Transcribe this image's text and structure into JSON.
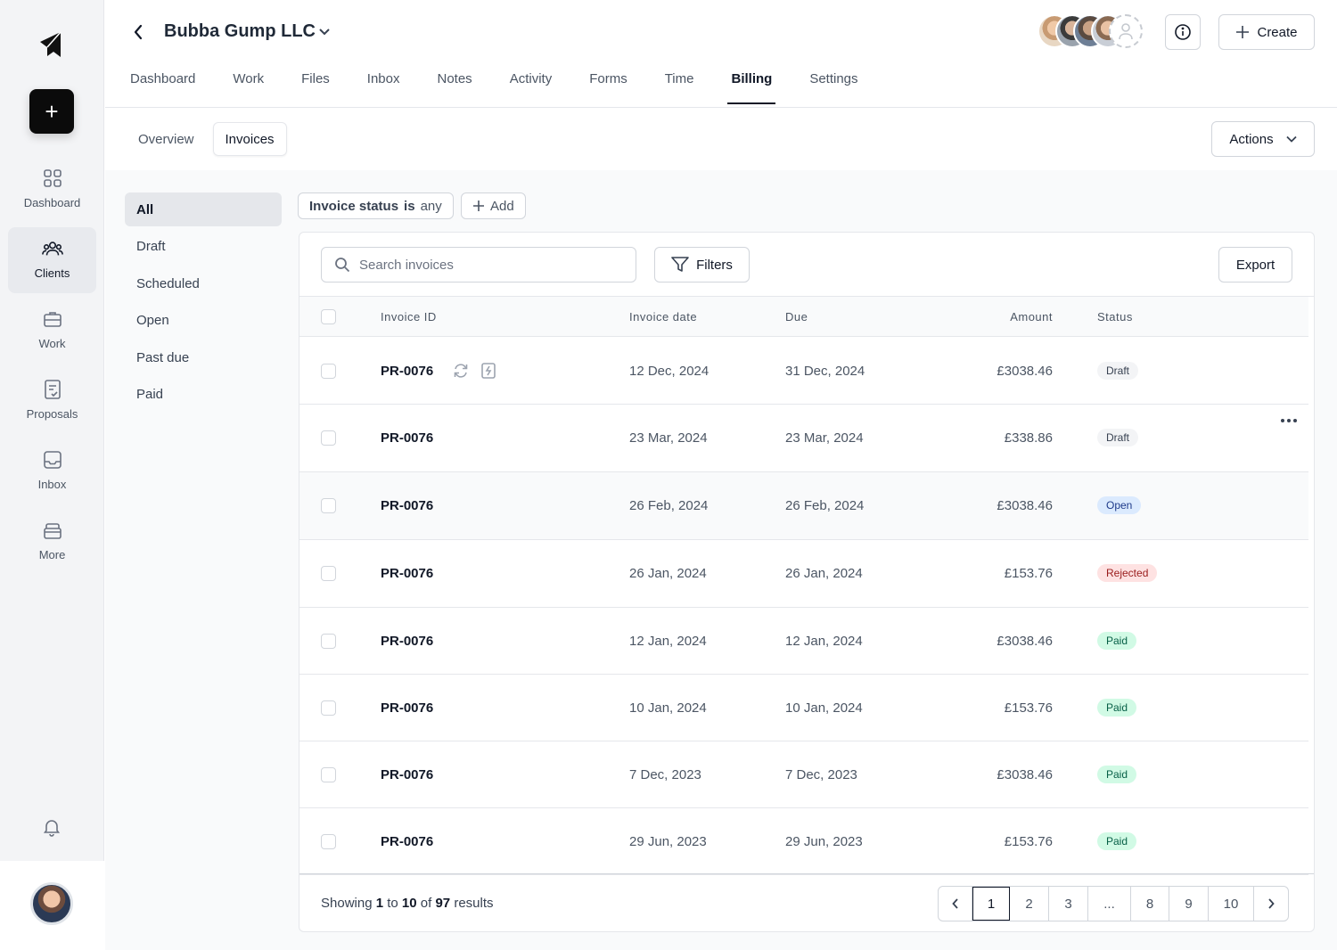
{
  "rail": {
    "new_label": "+",
    "items": [
      {
        "label": "Dashboard",
        "icon": "grid-icon"
      },
      {
        "label": "Clients",
        "icon": "users-icon",
        "active": true
      },
      {
        "label": "Work",
        "icon": "briefcase-icon"
      },
      {
        "label": "Proposals",
        "icon": "document-check-icon"
      },
      {
        "label": "Inbox",
        "icon": "inbox-icon"
      },
      {
        "label": "More",
        "icon": "box-icon"
      }
    ]
  },
  "header": {
    "client_name": "Bubba Gump LLC",
    "create_label": "Create",
    "tabs": [
      "Dashboard",
      "Work",
      "Files",
      "Inbox",
      "Notes",
      "Activity",
      "Forms",
      "Time",
      "Billing",
      "Settings"
    ],
    "active_tab": "Billing"
  },
  "subnav": {
    "items": [
      "Overview",
      "Invoices"
    ],
    "active": "Invoices",
    "actions_label": "Actions"
  },
  "side_filter": {
    "items": [
      "All",
      "Draft",
      "Scheduled",
      "Open",
      "Past due",
      "Paid"
    ],
    "active": "All"
  },
  "filter_chip": {
    "key": "Invoice status",
    "op": "is",
    "value": "any",
    "add_label": "Add"
  },
  "toolbar": {
    "search_placeholder": "Search invoices",
    "filters_label": "Filters",
    "export_label": "Export"
  },
  "table": {
    "columns": {
      "id": "Invoice ID",
      "date": "Invoice date",
      "due": "Due",
      "amount": "Amount",
      "status": "Status"
    },
    "rows": [
      {
        "id": "PR-0076",
        "date": "12 Dec, 2024",
        "due": "31 Dec, 2024",
        "amount": "£3038.46",
        "status": "Draft",
        "kind": "draft",
        "icons": true
      },
      {
        "id": "PR-0076",
        "date": "23 Mar, 2024",
        "due": "23 Mar, 2024",
        "amount": "£338.86",
        "status": "Draft",
        "kind": "draft",
        "more": true
      },
      {
        "id": "PR-0076",
        "date": "26 Feb, 2024",
        "due": "26 Feb, 2024",
        "amount": "£3038.46",
        "status": "Open",
        "kind": "open",
        "highlight": true
      },
      {
        "id": "PR-0076",
        "date": "26 Jan, 2024",
        "due": "26 Jan, 2024",
        "amount": "£153.76",
        "status": "Rejected",
        "kind": "rejected"
      },
      {
        "id": "PR-0076",
        "date": "12 Jan, 2024",
        "due": "12 Jan, 2024",
        "amount": "£3038.46",
        "status": "Paid",
        "kind": "paid"
      },
      {
        "id": "PR-0076",
        "date": "10 Jan, 2024",
        "due": "10 Jan, 2024",
        "amount": "£153.76",
        "status": "Paid",
        "kind": "paid"
      },
      {
        "id": "PR-0076",
        "date": "7 Dec, 2023",
        "due": "7 Dec, 2023",
        "amount": "£3038.46",
        "status": "Paid",
        "kind": "paid"
      },
      {
        "id": "PR-0076",
        "date": "29 Jun, 2023",
        "due": "29 Jun, 2023",
        "amount": "£153.76",
        "status": "Paid",
        "kind": "paid"
      }
    ]
  },
  "footer": {
    "showing": "Showing",
    "from": "1",
    "to_word": "to",
    "to": "10",
    "of_word": "of",
    "total": "97",
    "results_word": "results"
  },
  "pagination": {
    "pages": [
      "1",
      "2",
      "3",
      "...",
      "8",
      "9",
      "10"
    ],
    "current": "1"
  },
  "colors": {
    "accent": "#111827",
    "draft": "#f3f4f6",
    "open": "#dbeafe",
    "rejected": "#fee2e2",
    "paid": "#d1fae5"
  }
}
